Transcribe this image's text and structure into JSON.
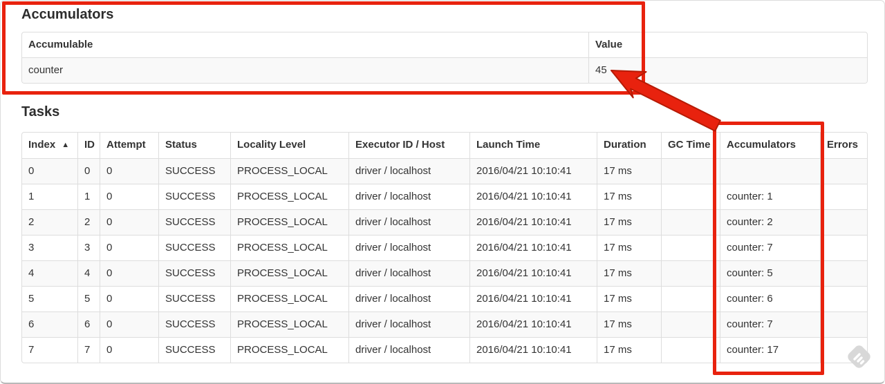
{
  "accumulators_section": {
    "heading": "Accumulators",
    "table": {
      "col_accumulable": "Accumulable",
      "col_value": "Value",
      "row": {
        "accumulable": "counter",
        "value": "45"
      }
    }
  },
  "tasks_section": {
    "heading": "Tasks",
    "table": {
      "headers": [
        "Index",
        "ID",
        "Attempt",
        "Status",
        "Locality Level",
        "Executor ID / Host",
        "Launch Time",
        "Duration",
        "GC Time",
        "Accumulators",
        "Errors"
      ],
      "sort_indicator": "▲",
      "columns": [
        "index",
        "id",
        "attempt",
        "status",
        "locality_level",
        "executor_id_host",
        "launch_time",
        "duration",
        "gc_time",
        "accumulators",
        "errors"
      ],
      "rows": [
        {
          "index": "0",
          "id": "0",
          "attempt": "0",
          "status": "SUCCESS",
          "locality_level": "PROCESS_LOCAL",
          "executor_id_host": "driver / localhost",
          "launch_time": "2016/04/21 10:10:41",
          "duration": "17 ms",
          "gc_time": "",
          "accumulators": "",
          "errors": ""
        },
        {
          "index": "1",
          "id": "1",
          "attempt": "0",
          "status": "SUCCESS",
          "locality_level": "PROCESS_LOCAL",
          "executor_id_host": "driver / localhost",
          "launch_time": "2016/04/21 10:10:41",
          "duration": "17 ms",
          "gc_time": "",
          "accumulators": "counter: 1",
          "errors": ""
        },
        {
          "index": "2",
          "id": "2",
          "attempt": "0",
          "status": "SUCCESS",
          "locality_level": "PROCESS_LOCAL",
          "executor_id_host": "driver / localhost",
          "launch_time": "2016/04/21 10:10:41",
          "duration": "17 ms",
          "gc_time": "",
          "accumulators": "counter: 2",
          "errors": ""
        },
        {
          "index": "3",
          "id": "3",
          "attempt": "0",
          "status": "SUCCESS",
          "locality_level": "PROCESS_LOCAL",
          "executor_id_host": "driver / localhost",
          "launch_time": "2016/04/21 10:10:41",
          "duration": "17 ms",
          "gc_time": "",
          "accumulators": "counter: 7",
          "errors": ""
        },
        {
          "index": "4",
          "id": "4",
          "attempt": "0",
          "status": "SUCCESS",
          "locality_level": "PROCESS_LOCAL",
          "executor_id_host": "driver / localhost",
          "launch_time": "2016/04/21 10:10:41",
          "duration": "17 ms",
          "gc_time": "",
          "accumulators": "counter: 5",
          "errors": ""
        },
        {
          "index": "5",
          "id": "5",
          "attempt": "0",
          "status": "SUCCESS",
          "locality_level": "PROCESS_LOCAL",
          "executor_id_host": "driver / localhost",
          "launch_time": "2016/04/21 10:10:41",
          "duration": "17 ms",
          "gc_time": "",
          "accumulators": "counter: 6",
          "errors": ""
        },
        {
          "index": "6",
          "id": "6",
          "attempt": "0",
          "status": "SUCCESS",
          "locality_level": "PROCESS_LOCAL",
          "executor_id_host": "driver / localhost",
          "launch_time": "2016/04/21 10:10:41",
          "duration": "17 ms",
          "gc_time": "",
          "accumulators": "counter: 7",
          "errors": ""
        },
        {
          "index": "7",
          "id": "7",
          "attempt": "0",
          "status": "SUCCESS",
          "locality_level": "PROCESS_LOCAL",
          "executor_id_host": "driver / localhost",
          "launch_time": "2016/04/21 10:10:41",
          "duration": "17 ms",
          "gc_time": "",
          "accumulators": "counter: 17",
          "errors": ""
        }
      ]
    }
  },
  "colors": {
    "annotation_red": "#e8220e",
    "annotation_red_dark": "#b61a04",
    "table_border": "#dddddd",
    "row_stripe": "#f9f9f9",
    "text": "#333333",
    "watermark_gray": "#d6d6d6"
  }
}
